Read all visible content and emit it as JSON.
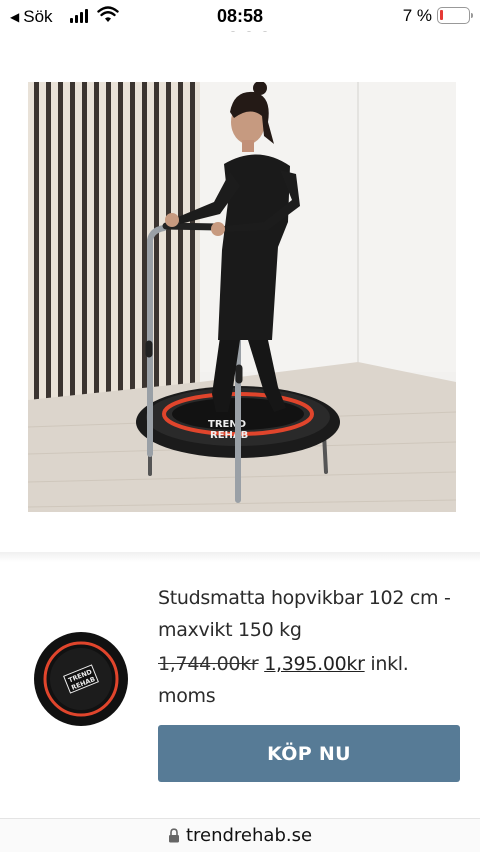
{
  "status_bar": {
    "back_label": "Sök",
    "time": "08:58",
    "battery_percent": "7 %"
  },
  "product": {
    "title": "Studsmatta hopvikbar 102 cm - maxvikt 150 kg",
    "old_price": "1,744.00kr",
    "new_price": "1,395.00kr",
    "price_suffix": " inkl. moms",
    "buy_label": "KÖP NU",
    "trampoline_brand_line1": "TREND",
    "trampoline_brand_line2": "REHAB"
  },
  "browser": {
    "url": "trendrehab.se"
  },
  "colors": {
    "buy_button": "#577b96",
    "trampoline_accent": "#e0452c"
  }
}
